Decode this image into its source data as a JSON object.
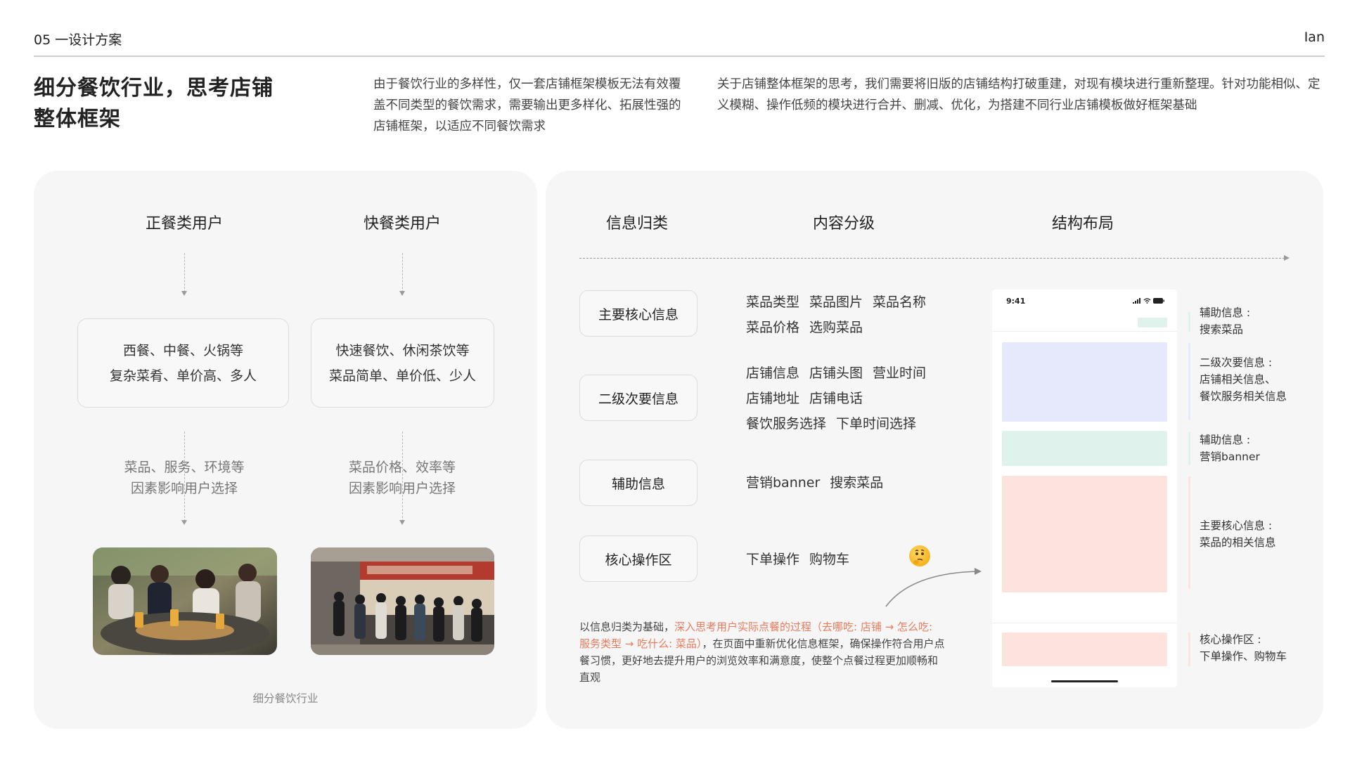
{
  "header": {
    "section": "05 一设计方案",
    "author": "Ian"
  },
  "intro": {
    "title_line1": "细分餐饮行业，思考店铺",
    "title_line2": "整体框架",
    "para1": "由于餐饮行业的多样性，仅一套店铺框架模板无法有效覆盖不同类型的餐饮需求，需要输出更多样化、拓展性强的店铺框架，以适应不同餐饮需求",
    "para2": "关于店铺整体框架的思考，我们需要将旧版的店铺结构打破重建，对现有模块进行重新整理。针对功能相似、定义模糊、操作低频的模块进行合并、删减、优化，为搭建不同行业店铺模板做好框架基础"
  },
  "left_panel": {
    "columns": [
      {
        "heading": "正餐类用户",
        "card_line1": "西餐、中餐、火锅等",
        "card_line2": "复杂菜肴、单价高、多人",
        "factor_line1": "菜品、服务、环境等",
        "factor_line2": "因素影响用户选择",
        "photo": "dining-photo"
      },
      {
        "heading": "快餐类用户",
        "card_line1": "快速餐饮、休闲茶饮等",
        "card_line2": "菜品简单、单价低、少人",
        "factor_line1": "菜品价格、效率等",
        "factor_line2": "因素影响用户选择",
        "photo": "fastfood-queue-photo"
      }
    ],
    "caption": "细分餐饮行业"
  },
  "right_panel": {
    "headings": [
      "信息归类",
      "内容分级",
      "结构布局"
    ],
    "rows": [
      {
        "category": "主要核心信息",
        "lines": [
          [
            "菜品类型",
            "菜品图片",
            "菜品名称"
          ],
          [
            "菜品价格",
            "选购菜品"
          ]
        ]
      },
      {
        "category": "二级次要信息",
        "lines": [
          [
            "店铺信息",
            "店铺头图",
            "营业时间"
          ],
          [
            "店铺地址",
            "店铺电话"
          ],
          [
            "餐饮服务选择",
            "下单时间选择"
          ]
        ]
      },
      {
        "category": "辅助信息",
        "lines": [
          [
            "营销banner",
            "搜索菜品"
          ]
        ]
      },
      {
        "category": "核心操作区",
        "lines": [
          [
            "下单操作",
            "购物车"
          ]
        ]
      }
    ],
    "note": {
      "before": "以信息归类为基础，",
      "highlight": "深入思考用户实际点餐的过程（去哪吃: 店铺 → 怎么吃: 服务类型 → 吃什么: 菜品）",
      "after": "，在页面中重新优化信息框架，确保操作符合用户点餐习惯，更好地去提升用户的浏览效率和满意度，使整个点餐过程更加顺畅和直观"
    },
    "phone": {
      "time": "9:41"
    },
    "labels": [
      {
        "line1": "辅助信息 :",
        "line2": "搜索菜品",
        "line3": ""
      },
      {
        "line1": "二级次要信息 :",
        "line2": "店铺相关信息、",
        "line3": "餐饮服务相关信息"
      },
      {
        "line1": "辅助信息 :",
        "line2": "营销banner",
        "line3": ""
      },
      {
        "line1": "主要核心信息 :",
        "line2": "菜品的相关信息",
        "line3": ""
      },
      {
        "line1": "核心操作区 :",
        "line2": "下单操作、购物车",
        "line3": ""
      }
    ],
    "colors": {
      "secondary": "#e6e8fb",
      "auxiliary": "#dff3ec",
      "core": "#fde3de",
      "highlight": "#ec7a5c"
    }
  }
}
